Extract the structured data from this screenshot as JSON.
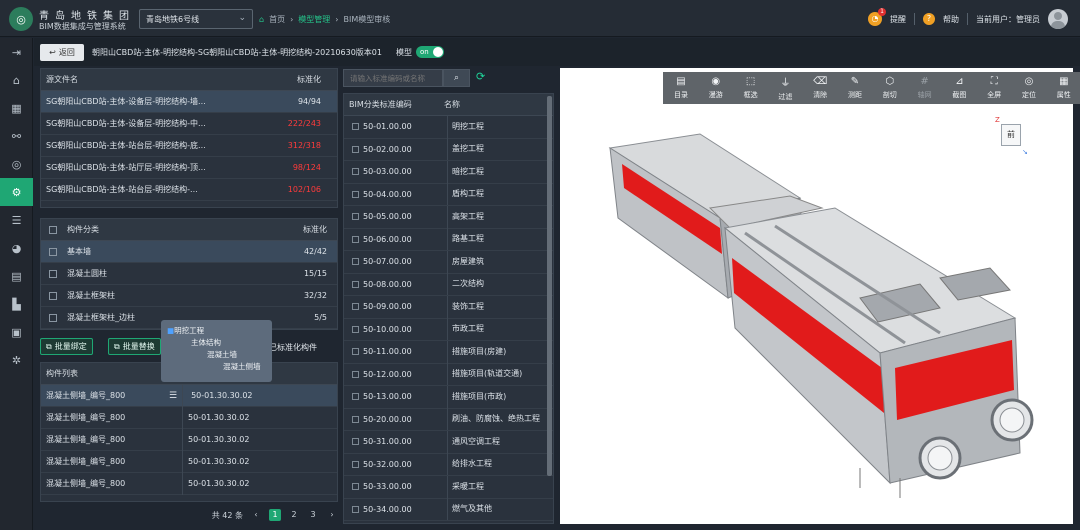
{
  "header": {
    "company": "青岛地铁集团",
    "system": "BIM数据集成与管理系统",
    "line_select": "青岛地铁6号线",
    "breadcrumb": [
      "首页",
      "模型管理",
      "BIM模型审核"
    ],
    "notify": "提醒",
    "notify_count": "1",
    "help": "帮助",
    "current_user": "当前用户：管理员"
  },
  "subbar": {
    "back": "返回",
    "file_title": "朝阳山CBD站-主体-明挖结构-SG朝阳山CBD站-主体-明挖结构-20210630版本01",
    "model_label": "模型",
    "toggle": "on"
  },
  "source_files": {
    "col_name": "源文件名",
    "col_std": "标准化",
    "rows": [
      {
        "name": "SG朝阳山CBD站-主体-设备层-明挖结构-墙...",
        "std": "94/94",
        "warn": false
      },
      {
        "name": "SG朝阳山CBD站-主体-设备层-明挖结构-中...",
        "std": "222/243",
        "warn": true
      },
      {
        "name": "SG朝阳山CBD站-主体-站台层-明挖结构-底...",
        "std": "312/318",
        "warn": true
      },
      {
        "name": "SG朝阳山CBD站-主体-站厅层-明挖结构-顶...",
        "std": "98/124",
        "warn": true
      },
      {
        "name": "SG朝阳山CBD站-主体-站台层-明挖结构-...",
        "std": "102/106",
        "warn": true
      }
    ]
  },
  "components": {
    "col_name": "构件分类",
    "col_std": "标准化",
    "rows": [
      {
        "name": "基本墙",
        "std": "42/42"
      },
      {
        "name": "混凝土圆柱",
        "std": "15/15"
      },
      {
        "name": "混凝土框架柱",
        "std": "32/32"
      },
      {
        "name": "混凝土框架柱_边柱",
        "std": "5/5"
      }
    ]
  },
  "actions": {
    "bind": "批量绑定",
    "replace": "批量替换",
    "std_label": "已标准化构件"
  },
  "tooltip": [
    "明挖工程",
    "主体结构",
    "混凝土墙",
    "混凝土侧墙"
  ],
  "member_list": {
    "title": "构件列表",
    "rows": [
      {
        "name": "混凝土侧墙_编号_800",
        "code": "50-01.30.30.02"
      },
      {
        "name": "混凝土侧墙_编号_800",
        "code": "50-01.30.30.02"
      },
      {
        "name": "混凝土侧墙_编号_800",
        "code": "50-01.30.30.02"
      },
      {
        "name": "混凝土侧墙_编号_800",
        "code": "50-01.30.30.02"
      },
      {
        "name": "混凝土侧墙_编号_800",
        "code": "50-01.30.30.02"
      }
    ]
  },
  "pager": {
    "total": "共 42 条",
    "prev": "‹",
    "pages": [
      "1",
      "2",
      "3"
    ],
    "next": "›"
  },
  "bim": {
    "search_placeholder": "请输入标准编码或名称",
    "col_code": "BIM分类标准编码",
    "col_name": "名称",
    "rows": [
      {
        "code": "50-01.00.00",
        "name": "明挖工程"
      },
      {
        "code": "50-02.00.00",
        "name": "盖挖工程"
      },
      {
        "code": "50-03.00.00",
        "name": "暗挖工程"
      },
      {
        "code": "50-04.00.00",
        "name": "盾构工程"
      },
      {
        "code": "50-05.00.00",
        "name": "高架工程"
      },
      {
        "code": "50-06.00.00",
        "name": "路基工程"
      },
      {
        "code": "50-07.00.00",
        "name": "房屋建筑"
      },
      {
        "code": "50-08.00.00",
        "name": "二次结构"
      },
      {
        "code": "50-09.00.00",
        "name": "装饰工程"
      },
      {
        "code": "50-10.00.00",
        "name": "市政工程"
      },
      {
        "code": "50-11.00.00",
        "name": "措施项目(房建)"
      },
      {
        "code": "50-12.00.00",
        "name": "措施项目(轨道交通)"
      },
      {
        "code": "50-13.00.00",
        "name": "措施项目(市政)"
      },
      {
        "code": "50-20.00.00",
        "name": "刷油、防腐蚀、绝热工程"
      },
      {
        "code": "50-31.00.00",
        "name": "通风空调工程"
      },
      {
        "code": "50-32.00.00",
        "name": "给排水工程"
      },
      {
        "code": "50-33.00.00",
        "name": "采暖工程"
      },
      {
        "code": "50-34.00.00",
        "name": "燃气及其他"
      }
    ]
  },
  "viewer": {
    "tools": [
      "目录",
      "漫游",
      "框选",
      "过滤",
      "清除",
      "测距",
      "剖切",
      "轴网",
      "截图",
      "全屏",
      "定位",
      "属性"
    ],
    "cube_label": "前"
  }
}
